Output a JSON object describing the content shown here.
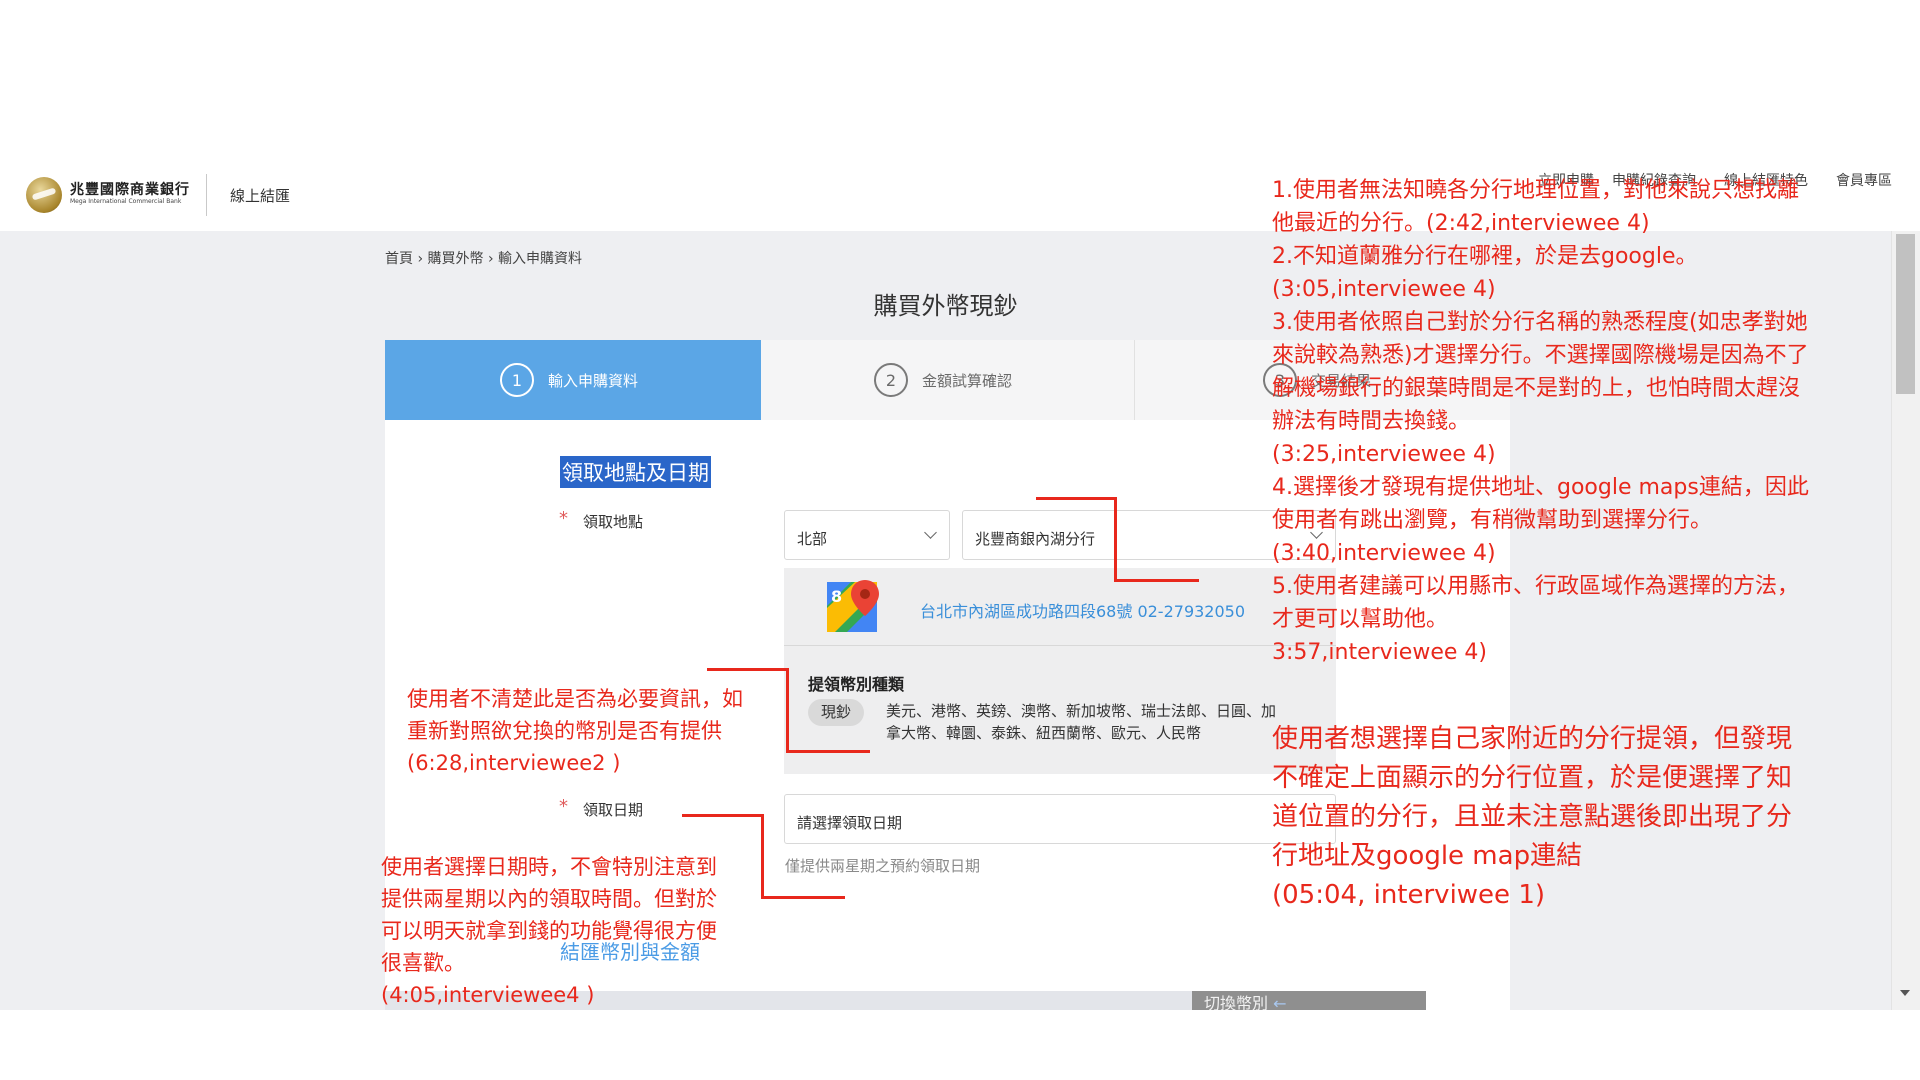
{
  "header": {
    "bank_name": "兆豐國際商業銀行",
    "bank_name_en": "Mega International Commercial Bank",
    "section_title": "線上結匯",
    "nav": [
      "立即申購",
      "申購紀錄查詢",
      "線上結匯特色",
      "會員專區"
    ]
  },
  "breadcrumb": [
    "首頁",
    "購買外幣",
    "輸入申購資料"
  ],
  "page_title": "購買外幣現鈔",
  "steps": [
    {
      "number": "1",
      "label": "輸入申購資料",
      "active": true
    },
    {
      "number": "2",
      "label": "金額試算確認",
      "active": false
    },
    {
      "number": "3",
      "label": "交易結果",
      "active": false
    }
  ],
  "form": {
    "section_heading": "領取地點及日期",
    "pickup_location_label": "領取地點",
    "required_mark": "*",
    "region_select": "北部",
    "branch_select": "兆豐商銀內湖分行",
    "branch_address": "台北市內湖區成功路四段68號 02-27932050",
    "currency_types_heading": "提領幣別種類",
    "cash_badge": "現鈔",
    "currency_list": "美元、港幣、英鎊、澳幣、新加坡幣、瑞士法郎、日圓、加拿大幣、韓圜、泰銖、紐西蘭幣、歐元、人民幣",
    "pickup_date_label": "領取日期",
    "date_placeholder": "請選擇領取日期",
    "date_hint": "僅提供兩星期之預約領取日期",
    "subsection_heading": "結匯幣別與金額",
    "switch_button": "切換幣別"
  },
  "annotations": {
    "top_right": "1.使用者無法知曉各分行地理位置，對他來說只想找離他最近的分行。(2:42,interviewee 4)\n2.不知道蘭雅分行在哪裡，於是去google。\n(3:05,interviewee 4)\n3.使用者依照自己對於分行名稱的熟悉程度(如忠孝對她來說較為熟悉)才選擇分行。不選擇國際機場是因為不了解機場銀行的銀葉時間是不是對的上，也怕時間太趕沒辦法有時間去換錢。\n(3:25,interviewee 4)\n4.選擇後才發現有提供地址、google maps連結，因此使用者有跳出瀏覽，有稍微幫助到選擇分行。\n(3:40,interviewee 4)\n5.使用者建議可以用縣市、行政區域作為選擇的方法，才更可以幫助他。\n3:57,interviewee 4)",
    "right_middle": "使用者想選擇自己家附近的分行提領，但發現不確定上面顯示的分行位置，於是便選擇了知道位置的分行，且並未注意點選後即出現了分行地址及google map連結\n(05:04, interviwee 1)",
    "left_middle": "使用者不清楚此是否為必要資訊，如重新對照欲兌換的幣別是否有提供(6:28,interviewee2 )",
    "left_bottom": "使用者選擇日期時，不會特別注意到提供兩星期以內的領取時間。但對於可以明天就拿到錢的功能覺得很方便很喜歡。\n(4:05,interviewee4 )"
  },
  "colors": {
    "annotation_red": "#e8281c",
    "step_active": "#5ba6e6",
    "link_blue": "#3a8fd9",
    "selection_blue": "#2a66c9"
  }
}
